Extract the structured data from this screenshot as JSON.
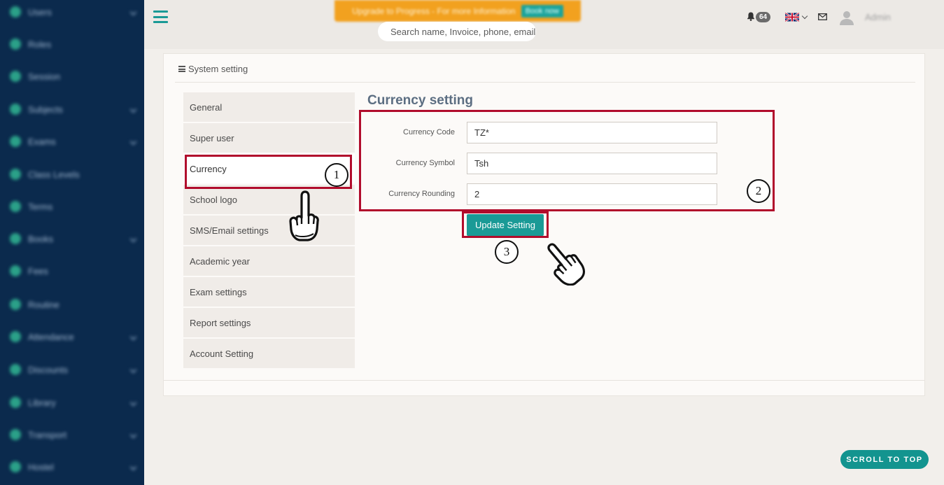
{
  "sidebar": {
    "items": [
      {
        "label": "Users",
        "has_children": true
      },
      {
        "label": "Roles",
        "has_children": false
      },
      {
        "label": "Session",
        "has_children": false
      },
      {
        "label": "Subjects",
        "has_children": true
      },
      {
        "label": "Exams",
        "has_children": true
      },
      {
        "label": "Class Levels",
        "has_children": false
      },
      {
        "label": "Terms",
        "has_children": false
      },
      {
        "label": "Books",
        "has_children": true
      },
      {
        "label": "Fees",
        "has_children": false
      },
      {
        "label": "Routine",
        "has_children": false
      },
      {
        "label": "Attendance",
        "has_children": true
      },
      {
        "label": "Discounts",
        "has_children": true
      },
      {
        "label": "Library",
        "has_children": true
      },
      {
        "label": "Transport",
        "has_children": true
      },
      {
        "label": "Hostel",
        "has_children": true
      }
    ]
  },
  "topbar": {
    "promo_text": "Upgrade to Progress - For more Information",
    "promo_button": "Book now",
    "search_placeholder": "Search name, Invoice, phone, email",
    "notification_count": "64",
    "user_name": "Admin"
  },
  "panel": {
    "heading": "System setting"
  },
  "tabs": [
    {
      "label": "General",
      "active": false
    },
    {
      "label": "Super user",
      "active": false
    },
    {
      "label": "Currency",
      "active": true
    },
    {
      "label": "School logo",
      "active": false
    },
    {
      "label": "SMS/Email settings",
      "active": false
    },
    {
      "label": "Academic year",
      "active": false
    },
    {
      "label": "Exam settings",
      "active": false
    },
    {
      "label": "Report settings",
      "active": false
    },
    {
      "label": "Account Setting",
      "active": false
    }
  ],
  "form": {
    "title": "Currency setting",
    "fields": [
      {
        "label": "Currency Code",
        "value": "TZ*"
      },
      {
        "label": "Currency Symbol",
        "value": "Tsh"
      },
      {
        "label": "Currency Rounding",
        "value": "2"
      }
    ],
    "submit_label": "Update Setting"
  },
  "annotations": {
    "step1": "1",
    "step2": "2",
    "step3": "3",
    "highlight_color": "#b10c2c"
  },
  "footer": {
    "scroll_top_label": "SCROLL TO TOP"
  },
  "colors": {
    "sidebar_bg": "#0b2a4d",
    "accent": "#1a9a96",
    "promo": "#f2a11f"
  }
}
